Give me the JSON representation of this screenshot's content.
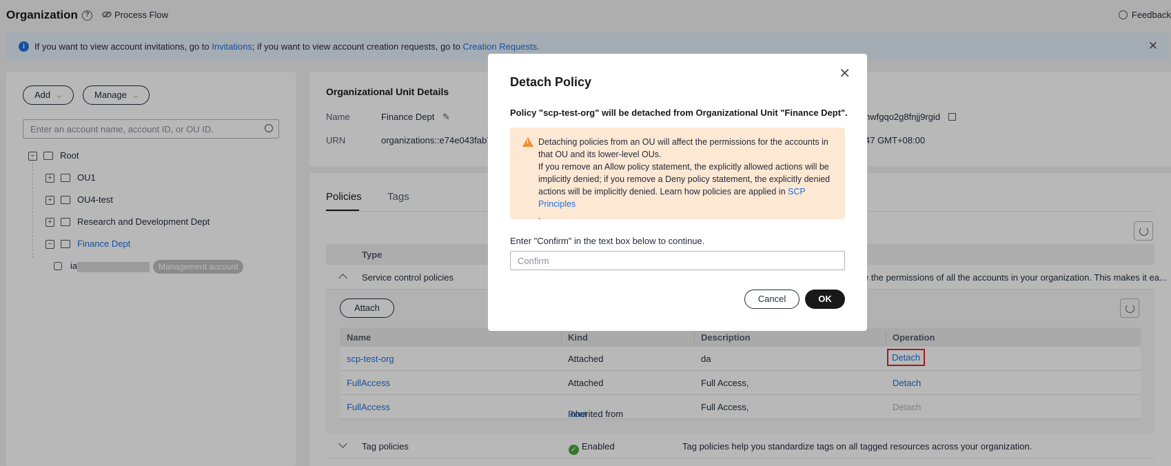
{
  "header": {
    "title": "Organization",
    "process_flow": "Process Flow",
    "feedback": "Feedback"
  },
  "banner": {
    "text_1": "If you want to view account invitations, go to ",
    "link_1": "Invitations",
    "text_2": "; if you want to view account creation requests, go to ",
    "link_2": "Creation Requests",
    "text_3": "."
  },
  "left": {
    "add_label": "Add",
    "manage_label": "Manage",
    "search_placeholder": "Enter an account name, account ID, or OU ID.",
    "tree": {
      "root": "Root",
      "ou1": "OU1",
      "ou4": "OU4-test",
      "rnd": "Research and Development Dept",
      "finance": "Finance Dept",
      "account_prefix": "ia",
      "mgmt_tag": "Management account"
    }
  },
  "ou_details": {
    "title": "Organizational Unit Details",
    "name_key": "Name",
    "name_val": "Finance Dept",
    "urn_key": "URN",
    "urn_val": "organizations::e74e043fab78",
    "id_val": "hwfgqo2g8fnjj9rgid",
    "time_val": "47 GMT+08:00"
  },
  "tabs": {
    "policies": "Policies",
    "tags": "Tags"
  },
  "policy_table": {
    "type_header": "Type",
    "scp": {
      "title": "Service control policies",
      "desc": "e the permissions of all the accounts in your organization. This makes it ea..."
    },
    "attach_label": "Attach",
    "headers": {
      "name": "Name",
      "kind": "Kind",
      "description": "Description",
      "operation": "Operation"
    },
    "rows": [
      {
        "name": "scp-test-org",
        "kind": "Attached",
        "kind_link": "",
        "description": "da",
        "operation": "Detach"
      },
      {
        "name": "FullAccess",
        "kind": "Attached",
        "kind_link": "",
        "description": "Full Access,",
        "operation": "Detach"
      },
      {
        "name": "FullAccess",
        "kind": "Inherited from ",
        "kind_link": "Root",
        "description": "Full Access,",
        "operation": "Detach"
      }
    ],
    "tag": {
      "title": "Tag policies",
      "status": "Enabled",
      "desc": "Tag policies help you standardize tags on all tagged resources across your organization."
    }
  },
  "modal": {
    "title": "Detach Policy",
    "description": "Policy \"scp-test-org\" will be detached from Organizational Unit \"Finance Dept\".",
    "warning_1": "Detaching policies from an OU will affect the permissions for the accounts in that OU and its lower-level OUs.",
    "warning_2": "If you remove an Allow policy statement, the explicitly allowed actions will be implicitly denied; if you remove a Deny policy statement, the explicitly denied actions will be implicitly denied. Learn how policies are applied in ",
    "warning_link": "SCP Principles",
    "warning_end": ".",
    "confirm_label": "Enter \"Confirm\" in the text box below to continue.",
    "confirm_placeholder": "Confirm",
    "cancel_label": "Cancel",
    "ok_label": "OK"
  },
  "colors": {
    "link": "#1f6fdc",
    "warning_bg": "#fde8d4",
    "warning_icon": "#f08d30",
    "primary_button": "#191919",
    "highlight_box": "#e0262a",
    "enabled": "#4aa73e"
  },
  "icons": {
    "help": "help-circle-icon",
    "process_flow": "eye-off-icon",
    "feedback": "smile-icon",
    "info": "info-icon",
    "close": "close-icon",
    "search": "search-icon",
    "refresh": "refresh-icon",
    "warning": "warning-icon",
    "enabled": "check-circle-icon"
  }
}
